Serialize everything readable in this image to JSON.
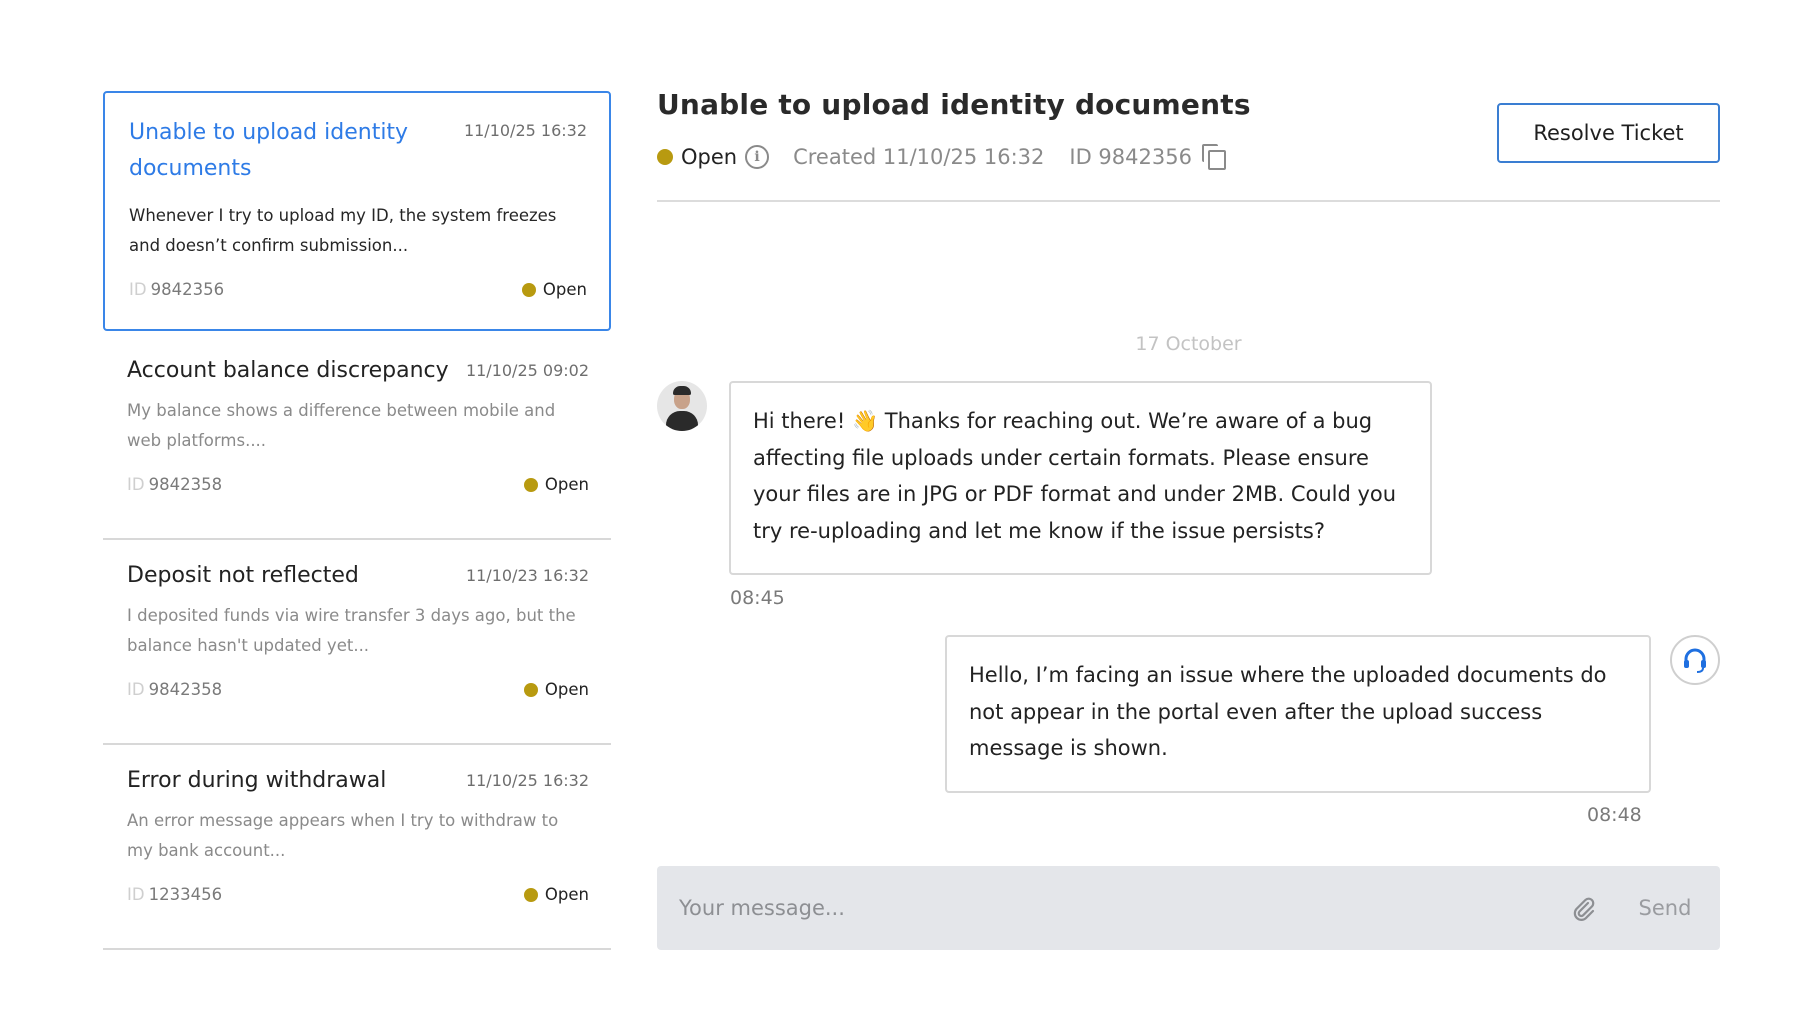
{
  "tickets": [
    {
      "title": "Unable to upload identity documents",
      "date": "11/10/25 16:32",
      "preview": "Whenever I try to upload my ID, the system freezes and doesn’t confirm submission...",
      "id_prefix": "ID",
      "id": "9842356",
      "status": "Open",
      "selected": true
    },
    {
      "title": "Account balance discrepancy",
      "date": "11/10/25 09:02",
      "preview": "My balance shows a difference between mobile and web platforms....",
      "id_prefix": "ID",
      "id": "9842358",
      "status": "Open",
      "selected": false
    },
    {
      "title": "Deposit not reflected",
      "date": "11/10/23 16:32",
      "preview": "I deposited funds via wire transfer 3 days ago, but the balance hasn't updated yet...",
      "id_prefix": "ID",
      "id": "9842358",
      "status": "Open",
      "selected": false
    },
    {
      "title": "Error during withdrawal",
      "date": "11/10/25 16:32",
      "preview": "An error message appears when I try to withdraw to my bank account...",
      "id_prefix": "ID",
      "id": "1233456",
      "status": "Open",
      "selected": false
    }
  ],
  "conversation": {
    "title": "Unable to upload identity documents",
    "status": "Open",
    "created": "Created 11/10/25 16:32",
    "id": "ID 9842356",
    "resolve_label": "Resolve Ticket",
    "date_separator": "17 October",
    "messages": [
      {
        "sender": "agent",
        "text": "Hi there! 👋 Thanks for reaching out. We’re aware of a bug affecting file uploads under certain formats. Please ensure your files are in JPG or PDF format and under 2MB. Could you try re-uploading and let me know if the issue persists?",
        "time": "08:45"
      },
      {
        "sender": "user",
        "text": "Hello, I’m facing an issue where the uploaded documents do not appear in the portal even after the upload success message is shown.",
        "time": "08:48"
      }
    ]
  },
  "composer": {
    "placeholder": "Your message...",
    "send_label": "Send"
  },
  "colors": {
    "accent": "#2e7be6",
    "status_open": "#b89a10",
    "agent_icon": "#1e6fe0"
  },
  "icons": [
    "info-icon",
    "copy-icon",
    "paperclip-icon",
    "headset-icon"
  ]
}
